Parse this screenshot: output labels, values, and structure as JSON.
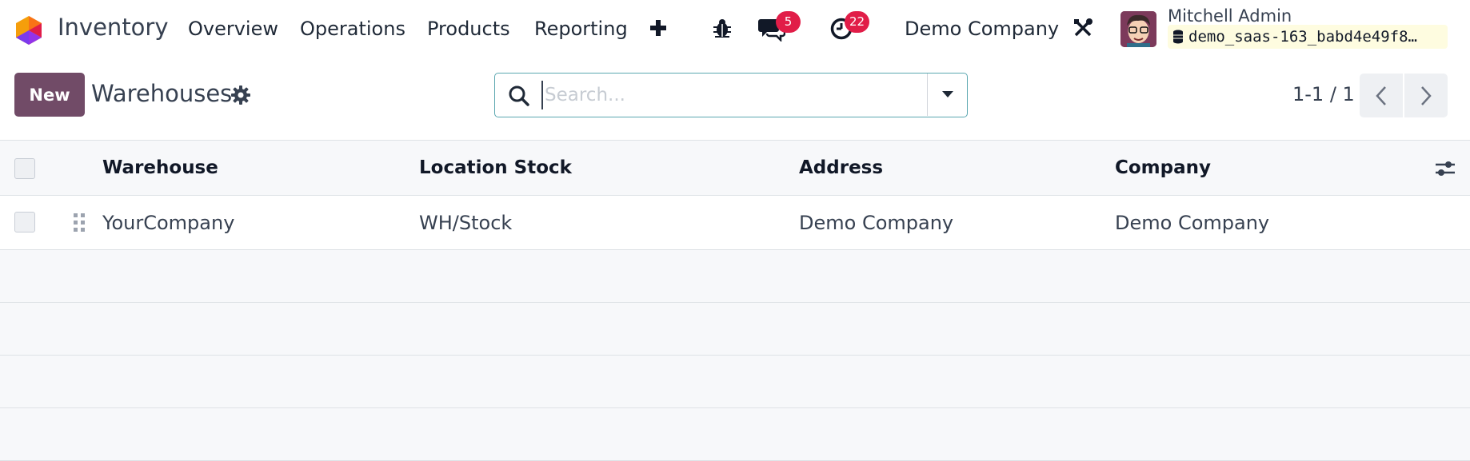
{
  "navbar": {
    "app_name": "Inventory",
    "menu": [
      "Overview",
      "Operations",
      "Products",
      "Reporting"
    ],
    "messages_count": "5",
    "activities_count": "22",
    "company": "Demo Company",
    "user_name": "Mitchell Admin",
    "database": "demo_saas-163_babd4e49f8…"
  },
  "control_panel": {
    "new_label": "New",
    "title": "Warehouses",
    "search_placeholder": "Search...",
    "pager": "1-1 / 1"
  },
  "table": {
    "columns": [
      "Warehouse",
      "Location Stock",
      "Address",
      "Company"
    ],
    "rows": [
      [
        "YourCompany",
        "WH/Stock",
        "Demo Company",
        "Demo Company"
      ]
    ]
  },
  "colors": {
    "brand": "#714b67",
    "badge": "#e11d48",
    "search_border": "#5ba7b0"
  },
  "icons": [
    "app-logo-icon",
    "plus-icon",
    "bug-icon",
    "chat-icon",
    "clock-icon",
    "tools-icon",
    "database-icon",
    "gear-icon",
    "search-icon",
    "caret-down-icon",
    "chevron-left-icon",
    "chevron-right-icon",
    "optional-columns-icon",
    "drag-handle-icon"
  ]
}
